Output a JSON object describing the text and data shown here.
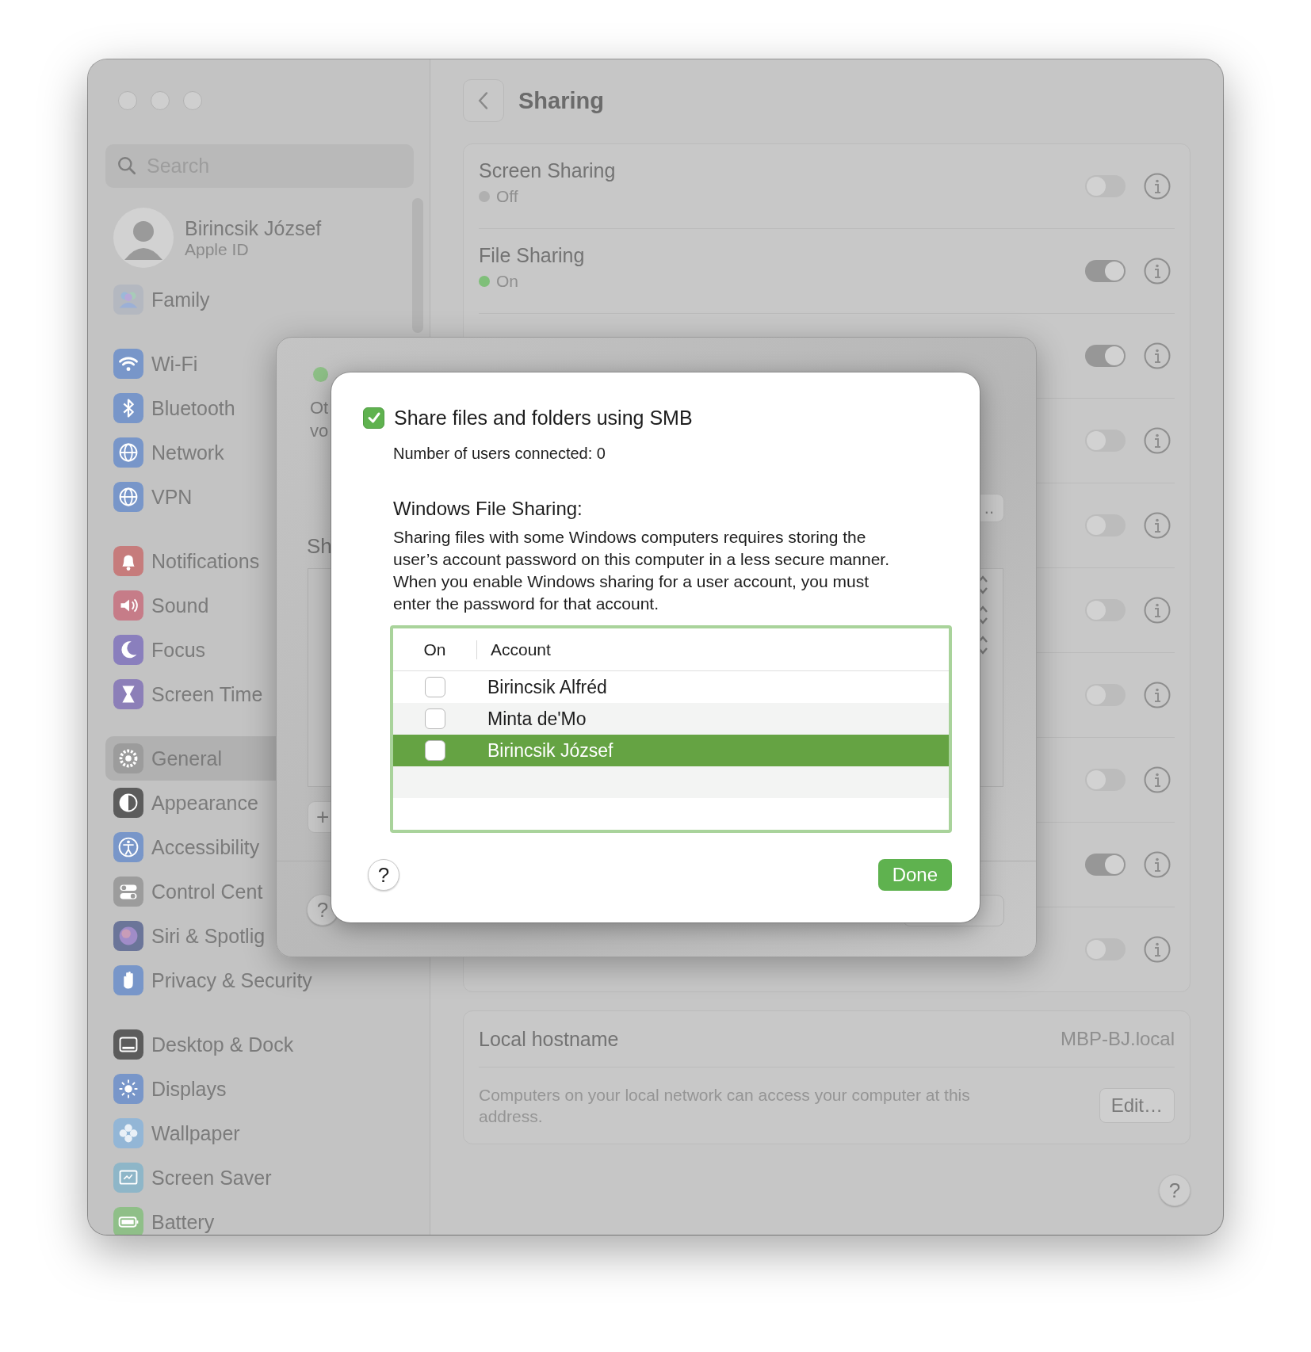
{
  "sidebar": {
    "search": {
      "placeholder": "Search"
    },
    "profile": {
      "name": "Birincsik József",
      "subtitle": "Apple ID"
    },
    "groups": [
      {
        "items": [
          {
            "label": "Family",
            "selected": false
          }
        ]
      },
      {
        "items": [
          {
            "label": "Wi-Fi",
            "selected": false
          },
          {
            "label": "Bluetooth",
            "selected": false
          },
          {
            "label": "Network",
            "selected": false
          },
          {
            "label": "VPN",
            "selected": false
          }
        ]
      },
      {
        "items": [
          {
            "label": "Notifications",
            "selected": false
          },
          {
            "label": "Sound",
            "selected": false
          },
          {
            "label": "Focus",
            "selected": false
          },
          {
            "label": "Screen Time",
            "selected": false
          }
        ]
      },
      {
        "items": [
          {
            "label": "General",
            "selected": true
          },
          {
            "label": "Appearance",
            "selected": false
          },
          {
            "label": "Accessibility",
            "selected": false
          },
          {
            "label": "Control Cent",
            "selected": false
          },
          {
            "label": "Siri & Spotlig",
            "selected": false
          },
          {
            "label": "Privacy & Security",
            "selected": false
          }
        ]
      },
      {
        "items": [
          {
            "label": "Desktop & Dock",
            "selected": false
          },
          {
            "label": "Displays",
            "selected": false
          },
          {
            "label": "Wallpaper",
            "selected": false
          },
          {
            "label": "Screen Saver",
            "selected": false
          },
          {
            "label": "Battery",
            "selected": false
          }
        ]
      }
    ]
  },
  "main": {
    "title": "Sharing",
    "services": [
      {
        "name": "Screen Sharing",
        "status": "Off",
        "on": false
      },
      {
        "name": "File Sharing",
        "status": "On",
        "on": true
      },
      {
        "on": true
      },
      {
        "on": false
      },
      {
        "on": false
      },
      {
        "on": false
      },
      {
        "on": false
      },
      {
        "on": false
      },
      {
        "on": true
      },
      {
        "on": false
      }
    ],
    "hostname": {
      "label": "Local hostname",
      "value": "MBP-BJ.local",
      "description": "Computers on your local network can access your computer at this address.",
      "button": "Edit…"
    },
    "help": "?"
  },
  "file_sharing_dialog": {
    "on": true,
    "description_lines": [
      "Ot",
      "vo"
    ],
    "heading": "Sh",
    "options_button": "..",
    "add_button": "+",
    "help": "?"
  },
  "smb_sheet": {
    "share_smb": {
      "label": "Share files and folders using SMB",
      "checked": true
    },
    "users_connected": "Number of users connected: 0",
    "section_title": "Windows File Sharing:",
    "description": "Sharing files with some Windows computers requires storing the user’s account password on this computer in a less secure manner. When you enable Windows sharing for a user account, you must enter the password for that account.",
    "table": {
      "columns": [
        "On",
        "Account"
      ],
      "rows": [
        {
          "account": "Birincsik Alfréd",
          "on": false,
          "selected": false
        },
        {
          "account": "Minta de'Mo",
          "on": false,
          "selected": false
        },
        {
          "account": "Birincsik József",
          "on": false,
          "selected": true
        }
      ]
    },
    "help": "?",
    "done": "Done"
  }
}
